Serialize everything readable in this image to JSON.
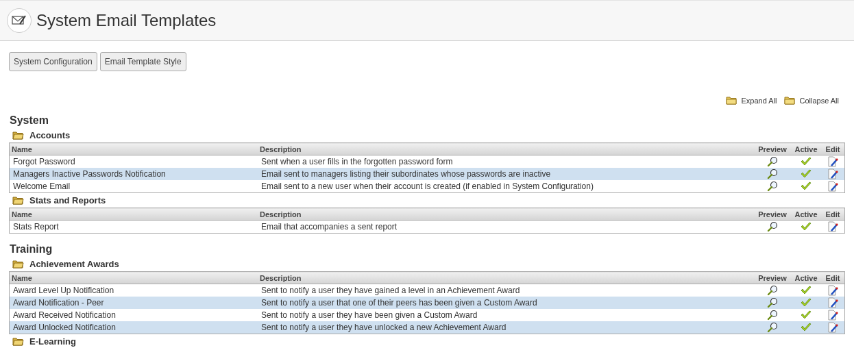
{
  "header": {
    "title": "System Email Templates"
  },
  "buttons": [
    "System Configuration",
    "Email Template Style"
  ],
  "tree_actions": [
    "Expand All",
    "Collapse All"
  ],
  "sections": [
    {
      "title": "System",
      "groups": [
        {
          "title": "Accounts",
          "columns": [
            "Name",
            "Description",
            "Preview",
            "Active",
            "Edit"
          ],
          "rows": [
            {
              "name": "Forgot Password",
              "description": "Sent when a user fills in the forgotten password form",
              "active": true
            },
            {
              "name": "Managers Inactive Passwords Notification",
              "description": "Email sent to managers listing their subordinates whose passwords are inactive",
              "active": true
            },
            {
              "name": "Welcome Email",
              "description": "Email sent to a new user when their account is created (if enabled in System Configuration)",
              "active": true
            }
          ]
        },
        {
          "title": "Stats and Reports",
          "columns": [
            "Name",
            "Description",
            "Preview",
            "Active",
            "Edit"
          ],
          "rows": [
            {
              "name": "Stats Report",
              "description": "Email that accompanies a sent report",
              "active": true
            }
          ]
        }
      ]
    },
    {
      "title": "Training",
      "groups": [
        {
          "title": "Achievement Awards",
          "columns": [
            "Name",
            "Description",
            "Preview",
            "Active",
            "Edit"
          ],
          "rows": [
            {
              "name": "Award Level Up Notification",
              "description": "Sent to notify a user they have gained a level in an Achievement Award",
              "active": true
            },
            {
              "name": "Award Notification - Peer",
              "description": "Sent to notify a user that one of their peers has been given a Custom Award",
              "active": true
            },
            {
              "name": "Award Received Notification",
              "description": "Sent to notify a user they have been given a Custom Award",
              "active": true
            },
            {
              "name": "Award Unlocked Notification",
              "description": "Sent to notify a user they have unlocked a new Achievement Award",
              "active": true
            }
          ]
        },
        {
          "title": "E-Learning"
        }
      ]
    }
  ]
}
